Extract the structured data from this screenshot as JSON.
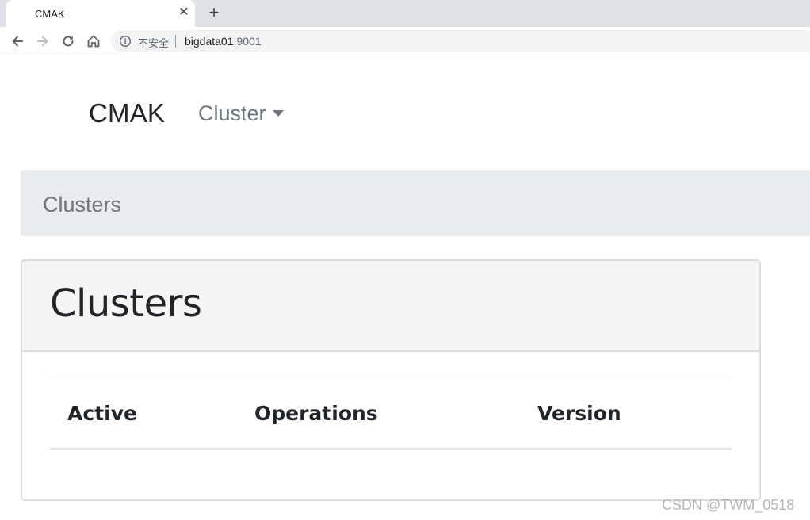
{
  "browser": {
    "tab_title": "CMAK",
    "tab_close_glyph": "✕",
    "new_tab_glyph": "+",
    "security_label": "不安全",
    "url_host": "bigdata01",
    "url_port": ":9001",
    "icons": [
      "back-icon",
      "forward-icon",
      "reload-icon",
      "home-icon",
      "info-icon"
    ]
  },
  "navbar": {
    "brand": "CMAK",
    "cluster_menu_label": "Cluster"
  },
  "breadcrumb": {
    "items": [
      "Clusters"
    ]
  },
  "card": {
    "title": "Clusters",
    "table": {
      "columns": [
        "Active",
        "Operations",
        "Version"
      ],
      "rows": []
    }
  },
  "watermark": "CSDN @TWM_0518",
  "colors": {
    "breadcrumb_bg": "#e9ecef",
    "card_header_bg": "#f5f5f5",
    "muted_text": "#6c757d",
    "tabstrip_bg": "#dee1e6"
  }
}
